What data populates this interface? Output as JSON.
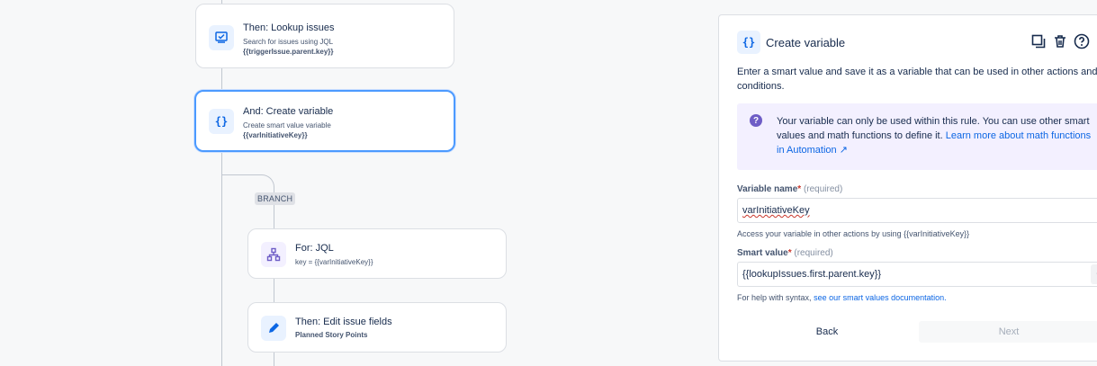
{
  "canvas": {
    "branch_label": "BRANCH",
    "nodes": [
      {
        "title": "Then: Lookup issues",
        "subtitle": "Search for issues using JQL",
        "detail": "{{triggerIssue.parent.key}}",
        "icon": "lookup-issues-icon"
      },
      {
        "title": "And: Create variable",
        "subtitle": "Create smart value variable",
        "detail": "{{varInitiativeKey}}",
        "icon": "curly-braces-icon"
      },
      {
        "title": "For: JQL",
        "subtitle": "key = {{varInitiativeKey}}",
        "icon": "branch-hierarchy-icon"
      },
      {
        "title": "Then: Edit issue fields",
        "detail": "Planned Story Points",
        "icon": "pencil-icon"
      }
    ]
  },
  "panel": {
    "icon_text": "{}",
    "title": "Create variable",
    "description": "Enter a smart value and save it as a variable that can be used in other actions and conditions.",
    "info": {
      "text": "Your variable can only be used within this rule. You can use other smart values and math functions to define it.",
      "link": "Learn more about math functions in Automation ↗"
    },
    "variable_name": {
      "label": "Variable name",
      "required": "(required)",
      "value": "varInitiativeKey",
      "helper": "Access your variable in other actions by using {{varInitiativeKey}}"
    },
    "smart_value": {
      "label": "Smart value",
      "required": "(required)",
      "value": "{{lookupIssues.first.parent.key}}",
      "button": "{}",
      "helper_prefix": "For help with syntax,",
      "helper_link": "see our smart values documentation."
    },
    "back_label": "Back",
    "next_label": "Next"
  },
  "colors": {
    "accent": "#0c66e4",
    "selected_border": "#4c9aff",
    "info_bg": "#f3f0ff"
  }
}
